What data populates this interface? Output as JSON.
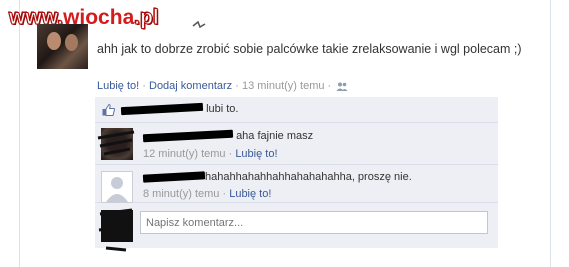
{
  "watermark": {
    "part1": "www.",
    "part2": "wiocha",
    "part3": ".pl"
  },
  "post": {
    "text": "ahh jak to dobrze zrobić sobie palcówke takie zrelaksowanie i wgl polecam ;)",
    "like_label": "Lubię to!",
    "comment_label": "Dodaj komentarz",
    "time": "13 minut(y) temu",
    "separator": "·",
    "audience_icon": "people-icon"
  },
  "likes": {
    "text": "lubi to.",
    "icon": "thumbs-up-icon"
  },
  "comments": [
    {
      "text": "aha fajnie masz",
      "time": "12 minut(y) temu",
      "like_label": "Lubię to!"
    },
    {
      "text": "hahahhahahhahhahahahahha, proszę nie.",
      "time": "8 minut(y) temu",
      "like_label": "Lubię to!"
    }
  ],
  "write_comment": {
    "placeholder": "Napisz komentarz..."
  },
  "colors": {
    "link": "#3b5998",
    "box_bg": "#edeff4",
    "watermark_red": "#d41c1c"
  }
}
